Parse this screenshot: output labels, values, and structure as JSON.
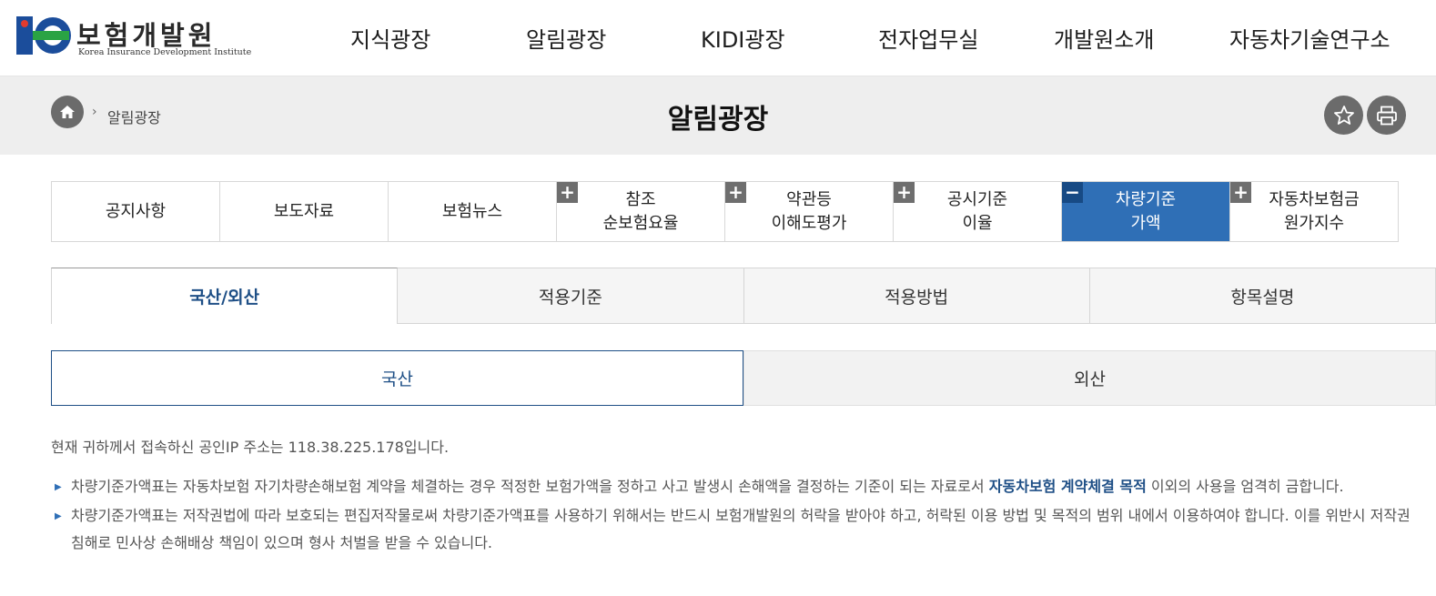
{
  "header": {
    "logo_ko": "보험개발원",
    "logo_en": "Korea Insurance Development Institute",
    "nav": [
      "지식광장",
      "알림광장",
      "KIDI광장",
      "전자업무실",
      "개발원소개",
      "자동차기술연구소"
    ]
  },
  "subbar": {
    "breadcrumb_sep": "›",
    "breadcrumb": "알림광장",
    "title": "알림광장"
  },
  "lnb": [
    {
      "label": "공지사항",
      "sign": ""
    },
    {
      "label": "보도자료",
      "sign": ""
    },
    {
      "label": "보험뉴스",
      "sign": ""
    },
    {
      "label": "참조\n순보험요율",
      "sign": "+"
    },
    {
      "label": "약관등\n이해도평가",
      "sign": "+"
    },
    {
      "label": "공시기준\n이율",
      "sign": "+"
    },
    {
      "label": "차량기준\n가액",
      "sign": "−"
    },
    {
      "label": "자동차보험금\n원가지수",
      "sign": "+"
    }
  ],
  "tabs2": [
    "국산/외산",
    "적용기준",
    "적용방법",
    "항목설명"
  ],
  "tabs3": [
    "국산",
    "외산"
  ],
  "content": {
    "ip_notice": "현재 귀하께서 접속하신 공인IP 주소는 118.38.225.178입니다.",
    "bullet": "▶",
    "note1_a": "차량기준가액표는 자동차보험 자기차량손해보험 계약을 체결하는 경우 적정한 보험가액을 정하고 사고 발생시 손해액을 결정하는 기준이 되는 자료로서 ",
    "note1_highlight": "자동차보험 계약체결 목적",
    "note1_b": " 이외의 사용을 엄격히 금합니다.",
    "note2": "차량기준가액표는 저작권법에 따라 보호되는 편집저작물로써 차량기준가액표를 사용하기 위해서는 반드시 보험개발원의 허락을 받아야 하고, 허락된 이용 방법 및 목적의 범위 내에서 이용하여야 합니다. 이를 위반시 저작권 침해로 민사상 손해배상 책임이 있으며 형사 처벌을 받을 수 있습니다."
  },
  "colors": {
    "active_blue": "#2f6fb6",
    "dark_blue": "#1e4f86",
    "subbar_gray": "#eeeeee"
  },
  "icons": [
    "home-icon",
    "star-icon",
    "print-icon",
    "plus-icon",
    "minus-icon"
  ]
}
